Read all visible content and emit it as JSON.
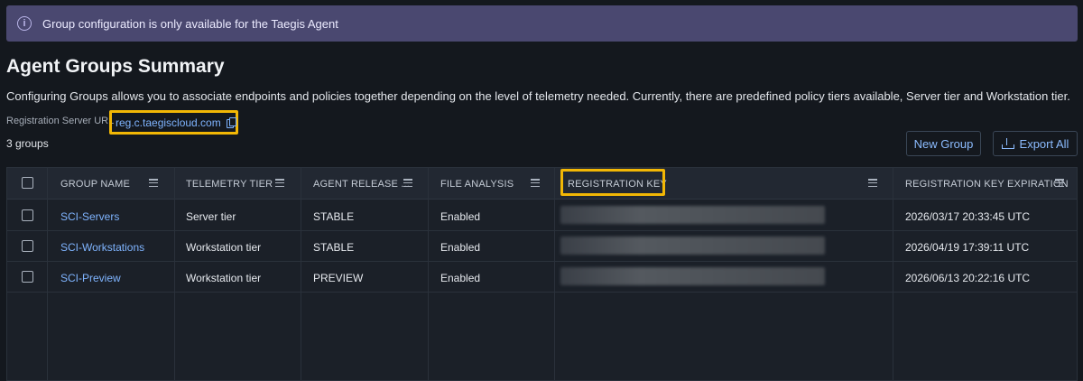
{
  "banner": {
    "text": "Group configuration is only available for the Taegis Agent",
    "icon": "info-icon"
  },
  "page": {
    "title": "Agent Groups Summary",
    "description": "Configuring Groups allows you to associate endpoints and policies together depending on the level of telemetry needed. Currently, there are predefined policy tiers available, Server tier and Workstation tier.",
    "registration_label": "Registration Server URL",
    "registration_url": "reg.c.taegiscloud.com",
    "group_count": "3 groups"
  },
  "toolbar": {
    "new_group": "New Group",
    "export_all": "Export All"
  },
  "table": {
    "columns": [
      "GROUP NAME",
      "TELEMETRY TIER",
      "AGENT RELEASE ...",
      "FILE ANALYSIS",
      "REGISTRATION KEY",
      "REGISTRATION KEY EXPIRATION"
    ],
    "rows": [
      {
        "name": "SCI-Servers",
        "tier": "Server tier",
        "release": "STABLE",
        "file_analysis": "Enabled",
        "expiration": "2026/03/17 20:33:45 UTC"
      },
      {
        "name": "SCI-Workstations",
        "tier": "Workstation tier",
        "release": "STABLE",
        "file_analysis": "Enabled",
        "expiration": "2026/04/19 17:39:11 UTC"
      },
      {
        "name": "SCI-Preview",
        "tier": "Workstation tier",
        "release": "PREVIEW",
        "file_analysis": "Enabled",
        "expiration": "2026/06/13 20:22:16 UTC"
      }
    ]
  },
  "colors": {
    "accent": "#7fb4ff",
    "highlight": "#f2b705",
    "banner": "#4a4870"
  }
}
